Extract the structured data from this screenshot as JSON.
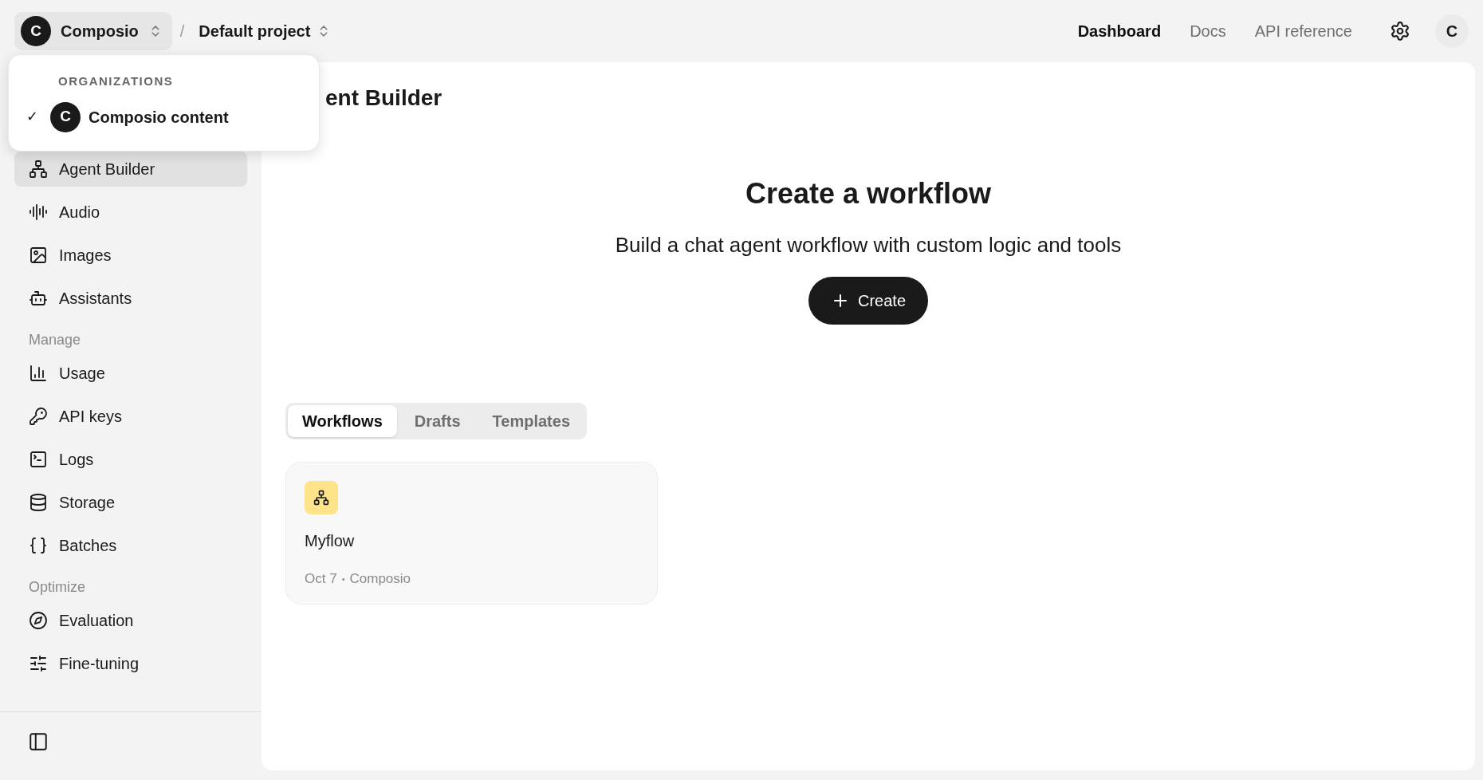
{
  "topbar": {
    "org": {
      "initial": "C",
      "name": "Composio"
    },
    "separator": "/",
    "project": "Default project",
    "links": [
      {
        "label": "Dashboard",
        "selected": true
      },
      {
        "label": "Docs",
        "selected": false
      },
      {
        "label": "API reference",
        "selected": false
      }
    ],
    "user_initial": "C"
  },
  "org_menu": {
    "heading": "ORGANIZATIONS",
    "items": [
      {
        "initial": "C",
        "name": "Composio content",
        "checked": true,
        "check": "✓"
      }
    ]
  },
  "sidebar": {
    "groups": [
      {
        "items": [
          {
            "label": "Agent Builder",
            "selected": true
          },
          {
            "label": "Audio",
            "selected": false
          },
          {
            "label": "Images",
            "selected": false
          },
          {
            "label": "Assistants",
            "selected": false
          }
        ]
      },
      {
        "heading": "Manage",
        "items": [
          {
            "label": "Usage",
            "selected": false
          },
          {
            "label": "API keys",
            "selected": false
          },
          {
            "label": "Logs",
            "selected": false
          },
          {
            "label": "Storage",
            "selected": false
          },
          {
            "label": "Batches",
            "selected": false
          }
        ]
      },
      {
        "heading": "Optimize",
        "items": [
          {
            "label": "Evaluation",
            "selected": false
          },
          {
            "label": "Fine-tuning",
            "selected": false
          }
        ]
      }
    ]
  },
  "main": {
    "title": "ent Builder",
    "hero": {
      "title": "Create a workflow",
      "subtitle": "Build a chat agent workflow with custom logic and tools",
      "button": "Create"
    },
    "tabs": [
      {
        "label": "Workflows",
        "selected": true
      },
      {
        "label": "Drafts",
        "selected": false
      },
      {
        "label": "Templates",
        "selected": false
      }
    ],
    "cards": [
      {
        "name": "Myflow",
        "date": "Oct 7",
        "owner": "Composio",
        "separator": "•"
      }
    ]
  }
}
